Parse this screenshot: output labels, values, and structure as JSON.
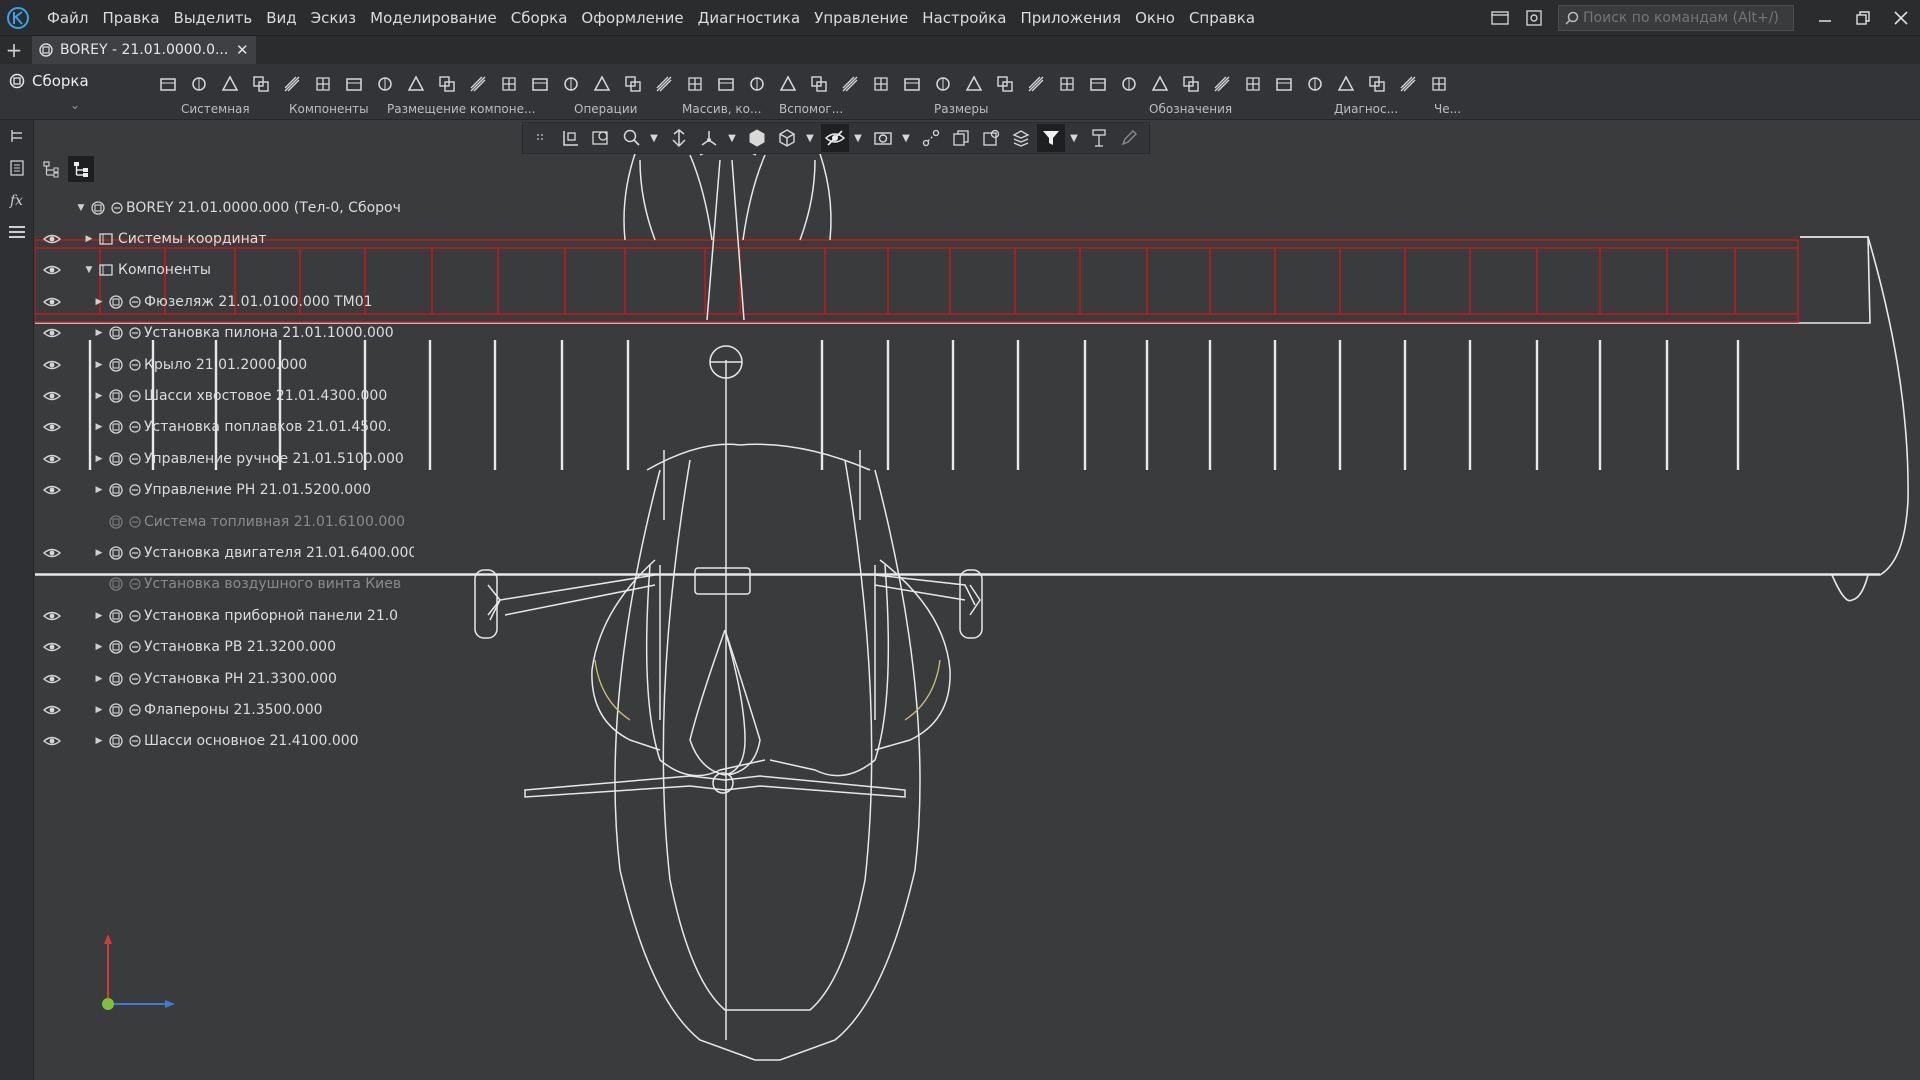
{
  "menu": {
    "items": [
      "Файл",
      "Правка",
      "Выделить",
      "Вид",
      "Эскиз",
      "Моделирование",
      "Сборка",
      "Оформление",
      "Диагностика",
      "Управление",
      "Настройка",
      "Приложения",
      "Окно",
      "Справка"
    ]
  },
  "search": {
    "placeholder": "Поиск по командам (Alt+/)"
  },
  "tab": {
    "title": "BOREY - 21.01.0000.0..."
  },
  "ribbon": {
    "mode_label": "Сборка",
    "groups": [
      {
        "label": "Системная"
      },
      {
        "label": "Компоненты"
      },
      {
        "label": "Размещение компоне..."
      },
      {
        "label": "Операции"
      },
      {
        "label": "Массив, ко..."
      },
      {
        "label": "Вспомог..."
      },
      {
        "label": "Размеры"
      },
      {
        "label": "Обозначения"
      },
      {
        "label": "Диагнос..."
      },
      {
        "label": "Че..."
      }
    ]
  },
  "tree": {
    "rows": [
      {
        "label": "BOREY 21.01.0000.000 (Тел-0, Сбороч",
        "level": 0,
        "eye": false,
        "arrow": "down",
        "dim": false
      },
      {
        "label": "Системы координат",
        "level": 1,
        "eye": true,
        "arrow": "right",
        "dim": false
      },
      {
        "label": "Компоненты",
        "level": 1,
        "eye": true,
        "arrow": "down",
        "dim": false
      },
      {
        "label": "Фюзеляж 21.01.0100.000 ТМ01",
        "level": 2,
        "eye": true,
        "arrow": "right",
        "dim": false
      },
      {
        "label": "Установка пилона 21.01.1000.000",
        "level": 2,
        "eye": true,
        "arrow": "right",
        "dim": false
      },
      {
        "label": "Крыло 21.01.2000.000",
        "level": 2,
        "eye": true,
        "arrow": "right",
        "dim": false
      },
      {
        "label": "Шасси хвостовое 21.01.4300.000",
        "level": 2,
        "eye": true,
        "arrow": "right",
        "dim": false
      },
      {
        "label": "Установка поплавков 21.01.4500.",
        "level": 2,
        "eye": true,
        "arrow": "right",
        "dim": false
      },
      {
        "label": "Управление ручное 21.01.5100.000",
        "level": 2,
        "eye": true,
        "arrow": "right",
        "dim": false
      },
      {
        "label": "Управление РН 21.01.5200.000",
        "level": 2,
        "eye": true,
        "arrow": "right",
        "dim": false
      },
      {
        "label": "Система топливная 21.01.6100.000",
        "level": 2,
        "eye": false,
        "arrow": "none",
        "dim": true
      },
      {
        "label": "Установка двигателя 21.01.6400.000",
        "level": 2,
        "eye": true,
        "arrow": "right",
        "dim": false
      },
      {
        "label": "Установка воздушного винта Киев",
        "level": 2,
        "eye": false,
        "arrow": "none",
        "dim": true
      },
      {
        "label": "Установка приборной панели 21.0",
        "level": 2,
        "eye": true,
        "arrow": "right",
        "dim": false
      },
      {
        "label": "Установка РВ 21.3200.000",
        "level": 2,
        "eye": true,
        "arrow": "right",
        "dim": false
      },
      {
        "label": "Установка РН 21.3300.000",
        "level": 2,
        "eye": true,
        "arrow": "right",
        "dim": false
      },
      {
        "label": "Флапероны 21.3500.000",
        "level": 2,
        "eye": true,
        "arrow": "right",
        "dim": false
      },
      {
        "label": "Шасси основное 21.4100.000",
        "level": 2,
        "eye": true,
        "arrow": "right",
        "dim": false
      }
    ]
  },
  "colors": {
    "background": "#3a3b3d",
    "wireframe": "#e8e8e8",
    "highlight": "#c01a1a",
    "accent": "#3aa3e3",
    "axis_x": "#3f7ad6",
    "axis_y": "#d23b3b",
    "axis_origin": "#7cc23a"
  }
}
